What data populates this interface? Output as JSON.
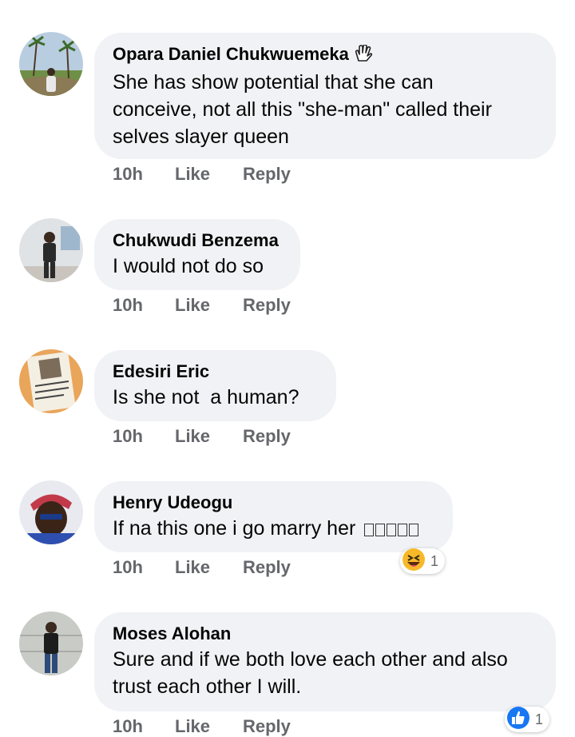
{
  "comments": [
    {
      "author": "Opara Daniel Chukwuemeka",
      "text_lines": [
        "She has show potential that she can",
        "conceive, not all this \"she-man\" called their",
        "selves slayer queen"
      ],
      "time": "10h",
      "like": "Like",
      "reply": "Reply"
    },
    {
      "author": "Chukwudi Benzema",
      "text_lines": [
        "I would not do so"
      ],
      "time": "10h",
      "like": "Like",
      "reply": "Reply"
    },
    {
      "author": "Edesiri Eric",
      "text_lines": [
        "Is she not  a human?"
      ],
      "time": "10h",
      "like": "Like",
      "reply": "Reply"
    },
    {
      "author": "Henry Udeogu",
      "text_lines": [
        "If na this one i go marry her"
      ],
      "time": "10h",
      "like": "Like",
      "reply": "Reply",
      "reaction": {
        "icon": "laughing-emoji-icon",
        "count": "1"
      }
    },
    {
      "author": "Moses Alohan",
      "text_lines": [
        "Sure and if we both love each other and also",
        "trust each other I will."
      ],
      "time": "10h",
      "like": "Like",
      "reply": "Reply",
      "reaction": {
        "icon": "like-thumb-icon",
        "count": "1"
      }
    }
  ],
  "colors": {
    "bubble": "#f0f2f5",
    "meta": "#65676b",
    "like_blue": "#1877f2"
  }
}
